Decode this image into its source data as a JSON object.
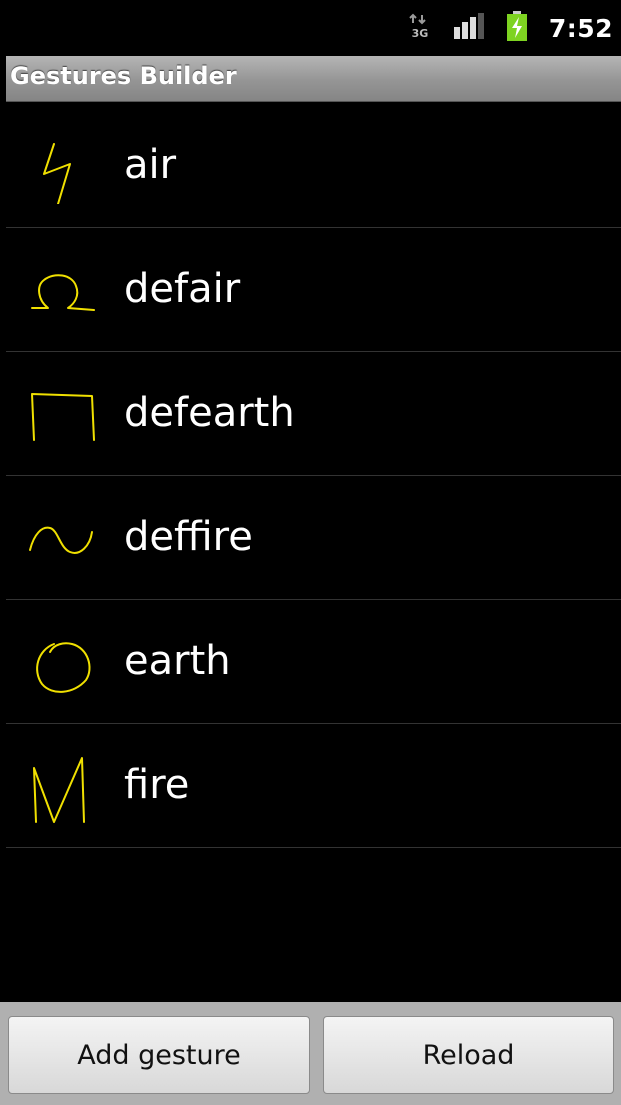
{
  "status_bar": {
    "network_icon": "3g-data-icon",
    "signal_icon": "signal-strength-icon",
    "battery_icon": "battery-charging-icon",
    "time": "7:52",
    "network_label": "3G"
  },
  "title_bar": {
    "title": "Gestures Builder"
  },
  "gestures": [
    {
      "label": "air",
      "icon": "gesture-air-icon"
    },
    {
      "label": "defair",
      "icon": "gesture-defair-icon"
    },
    {
      "label": "defearth",
      "icon": "gesture-defearth-icon"
    },
    {
      "label": "deffire",
      "icon": "gesture-deffire-icon"
    },
    {
      "label": "earth",
      "icon": "gesture-earth-icon"
    },
    {
      "label": "fire",
      "icon": "gesture-fire-icon"
    }
  ],
  "bottom_buttons": {
    "add_label": "Add gesture",
    "reload_label": "Reload"
  },
  "colors": {
    "gesture_stroke": "#f0e000",
    "background": "#000000",
    "title_bar": "#9a9a9a"
  }
}
